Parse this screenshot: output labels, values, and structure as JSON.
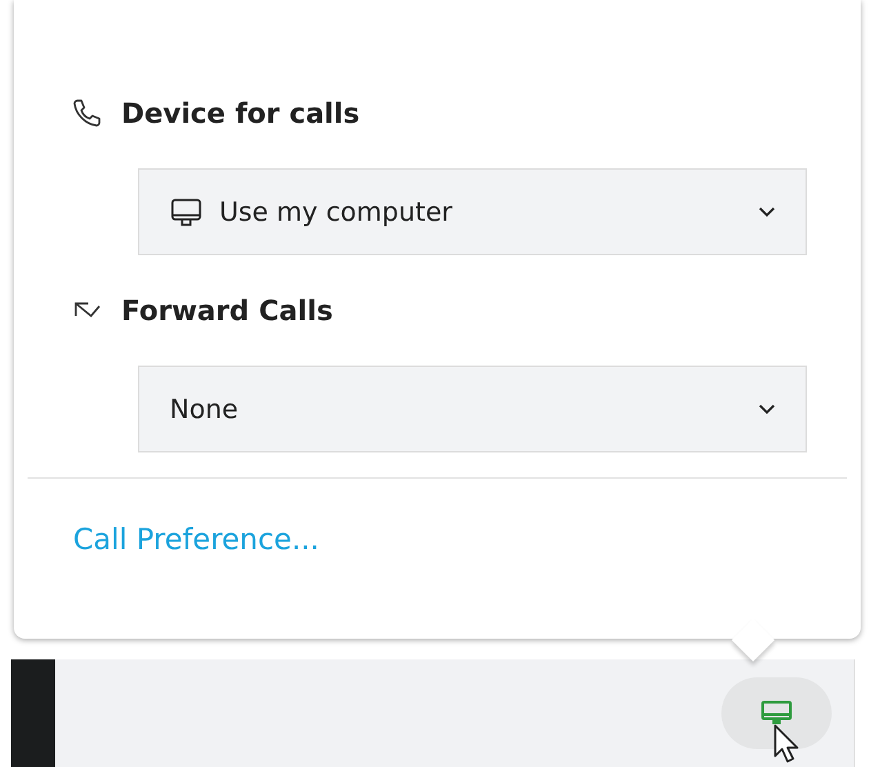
{
  "sections": [
    {
      "kind": "phone",
      "title": "Device for calls",
      "dropdown": {
        "kind": "computer",
        "value": "Use my computer"
      }
    },
    {
      "kind": "forward",
      "title": "Forward Calls",
      "dropdown": {
        "kind": "plain",
        "value": "None"
      }
    }
  ],
  "link": "Call Preference..."
}
